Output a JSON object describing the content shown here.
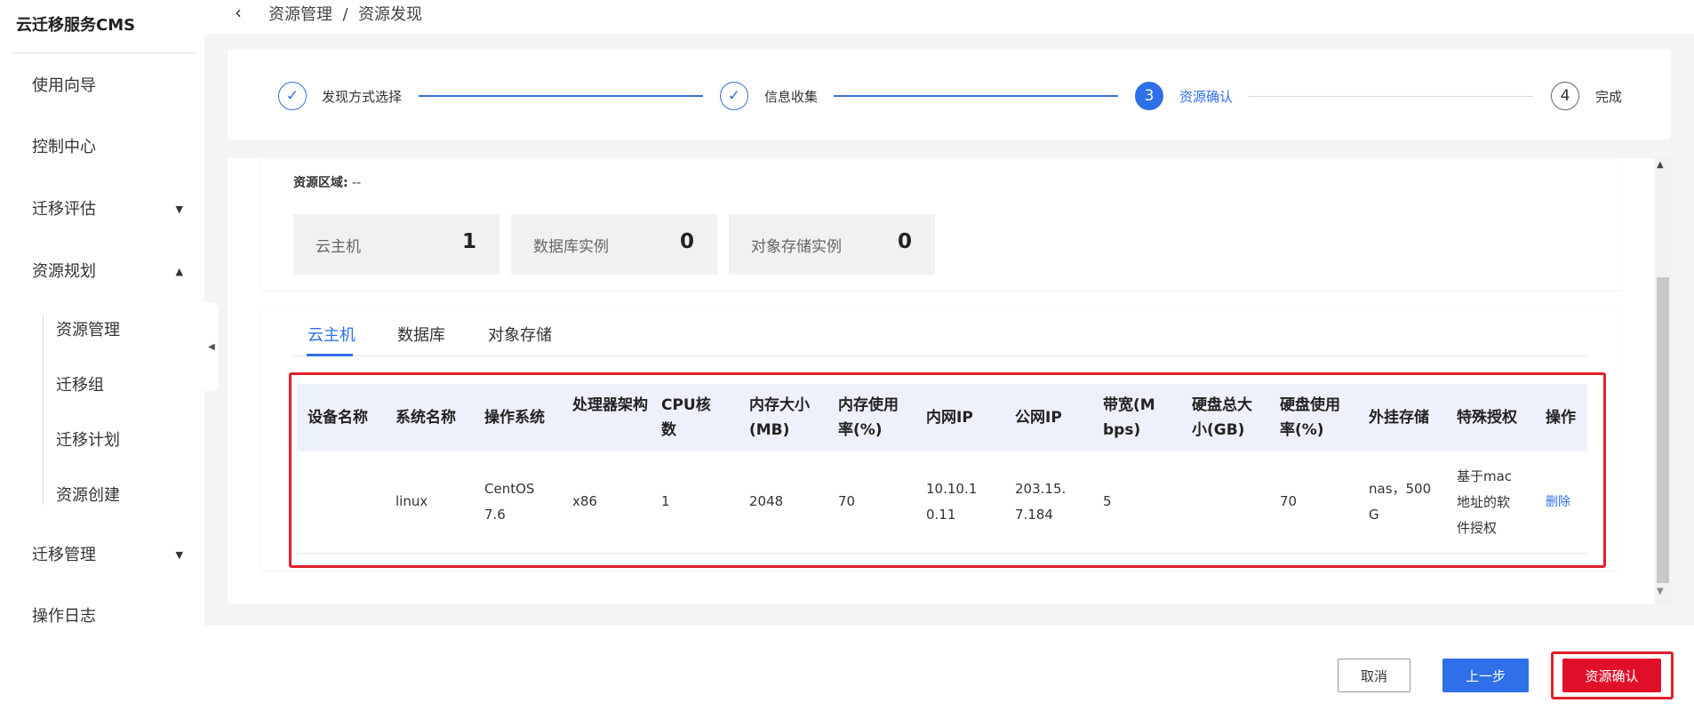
{
  "app": {
    "brand": "云迁移服务CMS"
  },
  "sidebar": {
    "items": [
      {
        "label": "使用向导"
      },
      {
        "label": "控制中心"
      },
      {
        "label": "迁移评估",
        "caret": "▼"
      },
      {
        "label": "资源规划",
        "caret": "▲"
      },
      {
        "label": "迁移管理",
        "caret": "▼"
      },
      {
        "label": "操作日志"
      }
    ],
    "sub_items": [
      {
        "label": "资源管理"
      },
      {
        "label": "迁移组"
      },
      {
        "label": "迁移计划"
      },
      {
        "label": "资源创建"
      }
    ],
    "collapse_glyph": "◀"
  },
  "header": {
    "back_glyph": "‹",
    "breadcrumb": "资源管理  /  资源发现"
  },
  "steps": [
    {
      "label": "发现方式选择",
      "status": "done",
      "marker": "✓"
    },
    {
      "label": "信息收集",
      "status": "done",
      "marker": "✓"
    },
    {
      "label": "资源确认",
      "status": "active",
      "marker": "3"
    },
    {
      "label": "完成",
      "status": "todo",
      "marker": "4"
    }
  ],
  "summary": {
    "region_label": "资源区域:",
    "region_value": "--",
    "stats": [
      {
        "label": "云主机",
        "value": "1"
      },
      {
        "label": "数据库实例",
        "value": "0"
      },
      {
        "label": "对象存储实例",
        "value": "0"
      }
    ]
  },
  "tabs": [
    {
      "label": "云主机",
      "active": true
    },
    {
      "label": "数据库",
      "active": false
    },
    {
      "label": "对象存储",
      "active": false
    }
  ],
  "table": {
    "headers": [
      "设备名称",
      "系统名称",
      "操作系统",
      "处理器架构",
      "CPU核数",
      "内存大小(MB)",
      "内存使用率(%)",
      "内网IP",
      "公网IP",
      "带宽(Mbps)",
      "硬盘总大小(GB)",
      "硬盘使用率(%)",
      "外挂存储",
      "特殊授权",
      "操作"
    ],
    "rows": [
      {
        "device_name": "",
        "system_name": "linux",
        "os": "CentOS 7.6",
        "arch": "x86",
        "cpu": "1",
        "memory": "2048",
        "mem_usage": "70",
        "private_ip": "10.10.10.11",
        "public_ip": "203.15.7.184",
        "bandwidth": "5",
        "disk_total": "",
        "disk_usage": "70",
        "external_storage": "nas，500G",
        "special_license": "基于mac地址的软件授权",
        "action": "删除"
      }
    ]
  },
  "footer": {
    "cancel": "取消",
    "prev": "上一步",
    "confirm": "资源确认"
  },
  "colors": {
    "primary": "#2f6fe8",
    "danger": "#e0102a",
    "highlight_box": "#e0202b"
  },
  "scrollbar": {
    "up_glyph": "▲",
    "down_glyph": "▼"
  }
}
